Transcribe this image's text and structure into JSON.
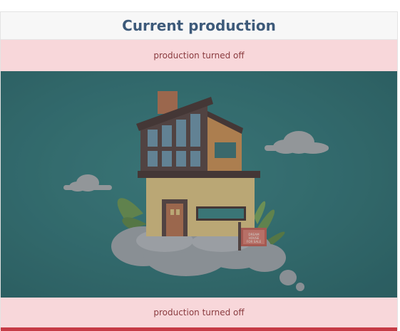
{
  "header": {
    "title": "Current production"
  },
  "status": {
    "top_message": "production turned off",
    "bottom_message": "production turned off"
  },
  "illustration": {
    "subject": "house-on-cloud",
    "sign_text": "DREAM HOUSE FOR SALE"
  },
  "colors": {
    "header_text": "#3d5a7a",
    "banner_bg": "#f8d7da",
    "banner_text": "#8a3b3f",
    "image_bg": "#336b6e",
    "accent_strip": "#c63b46"
  }
}
